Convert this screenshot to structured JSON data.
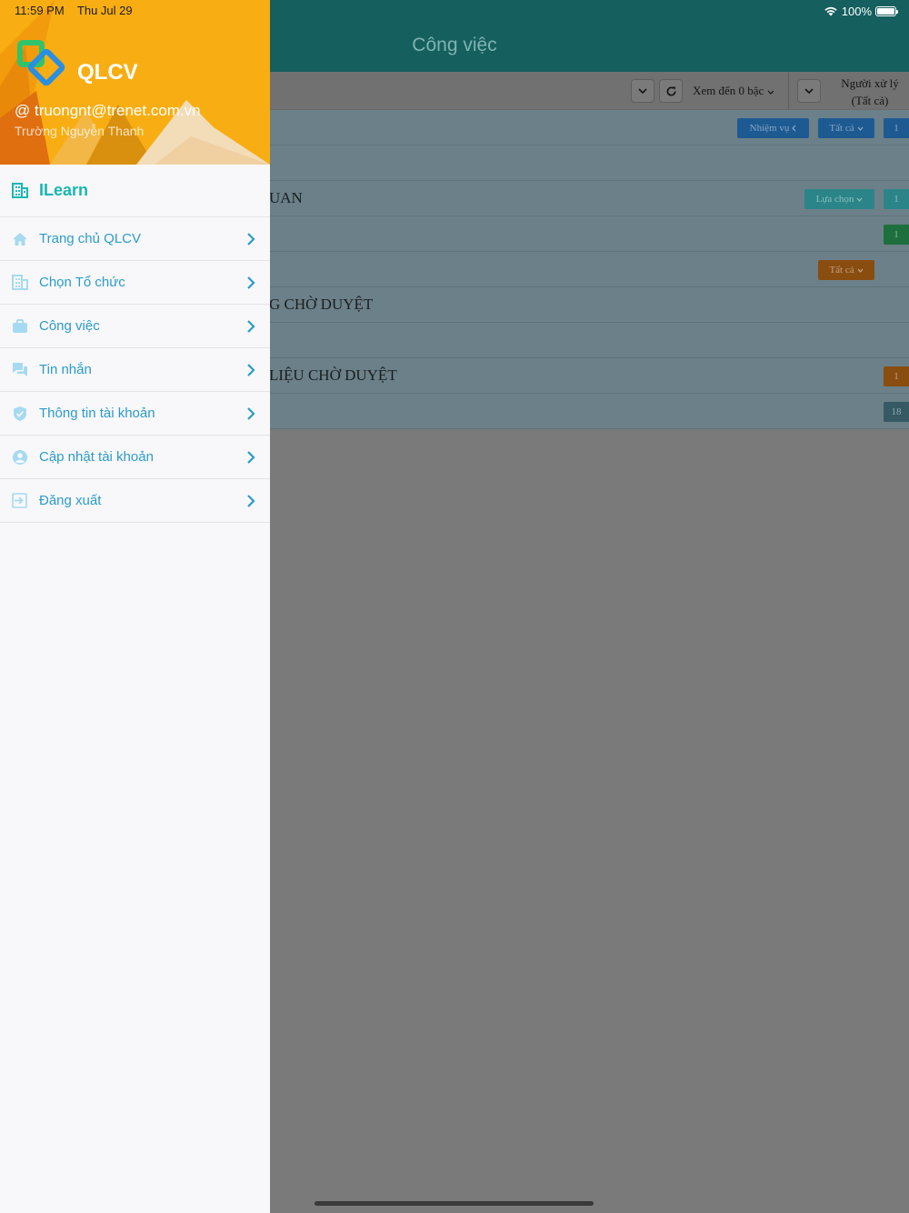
{
  "status_bar": {
    "time": "11:59 PM",
    "date": "Thu Jul 29",
    "battery": "100%",
    "wifi_icon": "wifi-icon",
    "battery_icon": "battery-icon"
  },
  "app": {
    "title": "Công việc",
    "toolbar": {
      "view_depth_label": "Xem đến 0 bậc",
      "assignee_label_line1": "Người xử lý",
      "assignee_label_line2": "(Tất cả)"
    },
    "rows": [
      {
        "text": "",
        "pills": [
          "Nhiệm vụ",
          "Tất cả"
        ],
        "count": "1"
      },
      {
        "text": "",
        "pills": [],
        "count": ""
      },
      {
        "text": "UAN",
        "pills": [
          "Lựa chọn"
        ],
        "count": "1"
      },
      {
        "text": "",
        "pills": [],
        "count": "1"
      },
      {
        "text": "",
        "pills": [
          "Tất cả"
        ],
        "count": ""
      },
      {
        "text": "G CHỜ DUYỆT",
        "pills": [],
        "count": ""
      },
      {
        "text": "",
        "pills": [],
        "count": ""
      },
      {
        "text": "LIỆU CHỜ DUYỆT",
        "pills": [],
        "count": "1"
      },
      {
        "text": "",
        "pills": [],
        "count": "18"
      }
    ]
  },
  "drawer": {
    "brand": "QLCV",
    "email": "@ truongnt@trenet.com.vn",
    "user_name": "Trường Nguyễn Thanh",
    "section_title": "ILearn",
    "items": [
      {
        "label": "Trang chủ QLCV",
        "icon": "home-icon"
      },
      {
        "label": "Chọn Tổ chức",
        "icon": "building-icon"
      },
      {
        "label": "Công việc",
        "icon": "briefcase-icon"
      },
      {
        "label": "Tin nhắn",
        "icon": "chat-icon"
      },
      {
        "label": "Thông tin tài khoản",
        "icon": "shield-check-icon"
      },
      {
        "label": "Cập nhật tài khoản",
        "icon": "user-circle-icon"
      },
      {
        "label": "Đăng xuất",
        "icon": "logout-icon"
      }
    ]
  },
  "colors": {
    "accent_teal": "#19b7b3",
    "menu_blue": "#2b9bcb",
    "header_orange": "#f8ae13",
    "app_header": "#155f5f"
  }
}
